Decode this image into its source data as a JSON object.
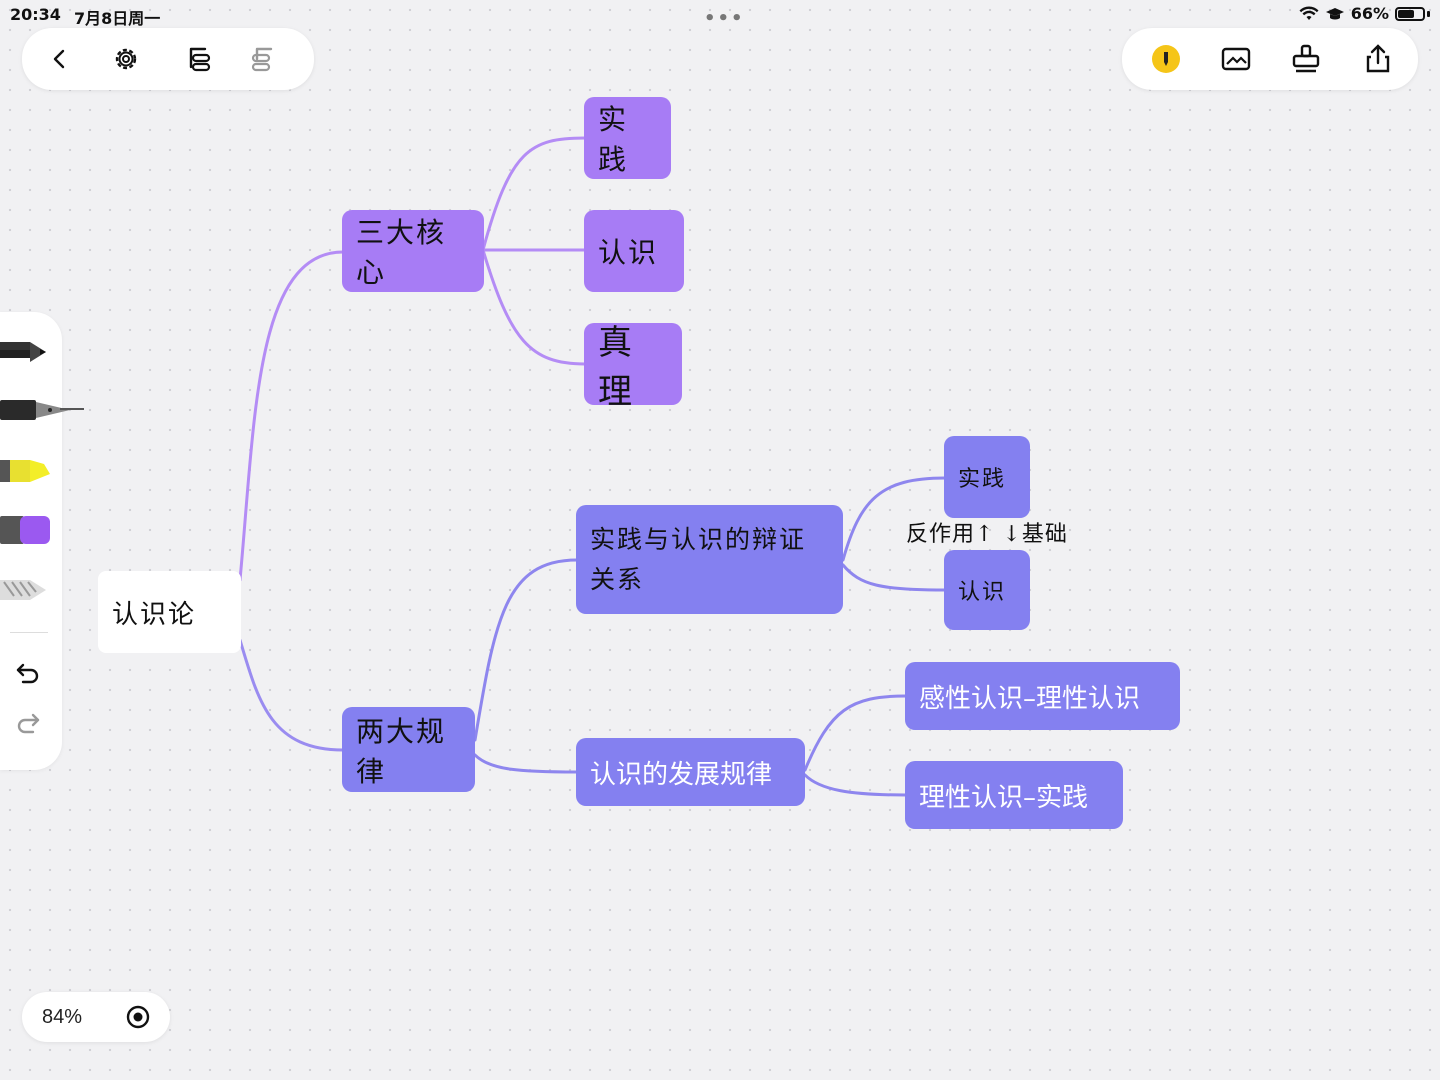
{
  "status_bar": {
    "time": "20:34",
    "date": "7月8日周一",
    "battery": "66%",
    "battery_level": 0.66,
    "dots": "•••"
  },
  "toolbar_left": {
    "icons": [
      "back-icon",
      "settings-icon",
      "mindmap-layout-icon",
      "mindmap-layout-alt-icon"
    ]
  },
  "toolbar_right": {
    "icons": [
      "pencil-mode-icon",
      "image-icon",
      "stamp-icon",
      "share-icon"
    ]
  },
  "left_tools": {
    "icons": [
      "pencil-tool",
      "fountain-pen-tool",
      "highlighter-tool",
      "eraser-tool",
      "lasso-tool",
      "undo-icon",
      "redo-icon"
    ]
  },
  "zoom": {
    "level": "84%",
    "icon": "target-icon"
  },
  "mindmap": {
    "root": "认识论",
    "branch_core": "三大核心",
    "core_children": [
      "实践",
      "认识",
      "真理"
    ],
    "branch_laws": "两大规律",
    "law_1": "实践与认识的辩证关系",
    "law_1_children": [
      "实践",
      "认识"
    ],
    "law_1_annotation": "反作用↑ ↓基础",
    "law_2": "认识的发展规律",
    "law_2_children": [
      "感性认识–理性认识",
      "理性认识–实践"
    ]
  },
  "colors": {
    "light_purple": "#a77cf5",
    "indigo": "#8480f0",
    "connector_light": "#b48cf5",
    "connector_indigo": "#8e86ee",
    "root_bg": "#ffffff"
  }
}
